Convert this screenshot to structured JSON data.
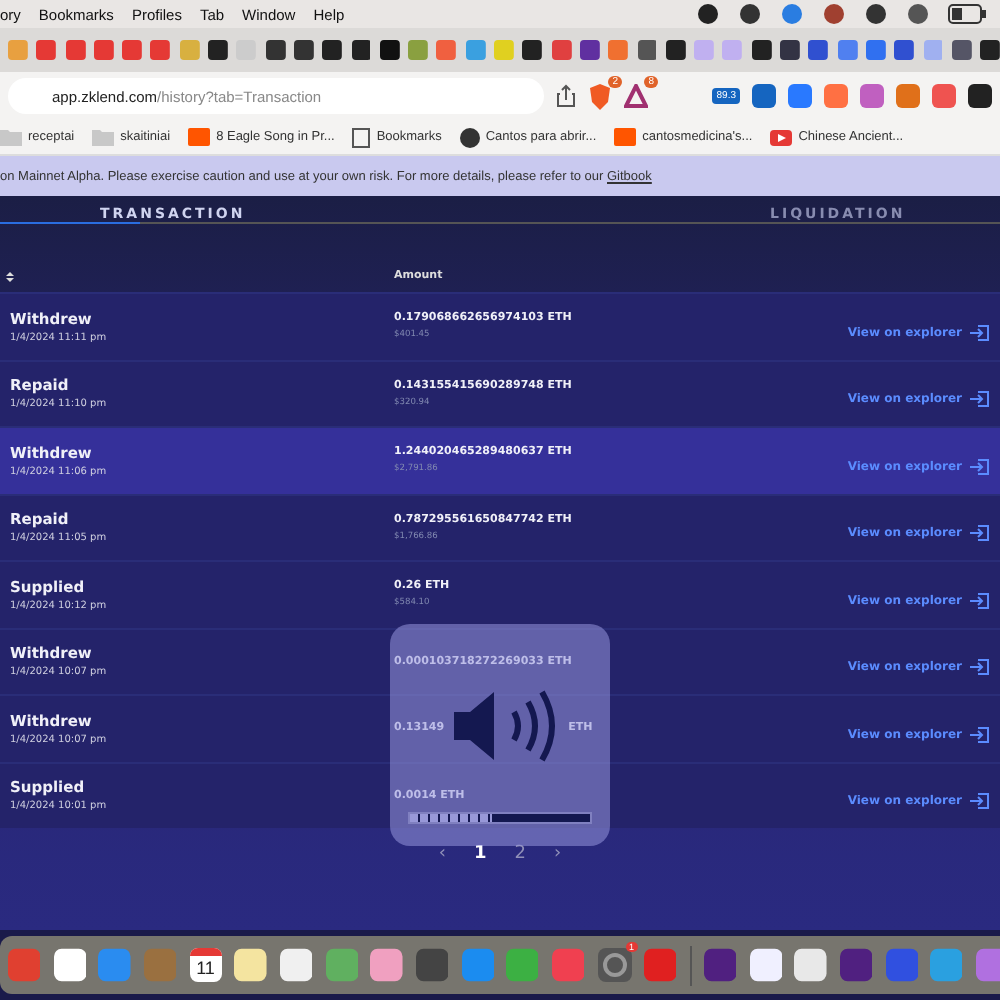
{
  "menu_bar": {
    "items": [
      "ory",
      "Bookmarks",
      "Profiles",
      "Tab",
      "Window",
      "Help"
    ]
  },
  "address_bar": {
    "host": "app.zklend.com",
    "path": "/history?tab=Transaction",
    "brave_badge": "2",
    "rewards_badge": "8",
    "extension_reading": "89.3"
  },
  "bookmarks": [
    {
      "label": "receptai",
      "kind": "folder"
    },
    {
      "label": "skaitiniai",
      "kind": "folder"
    },
    {
      "label": "8 Eagle Song in Pr...",
      "kind": "cloud"
    },
    {
      "label": "Bookmarks",
      "kind": "book"
    },
    {
      "label": "Cantos para abrir...",
      "kind": "globe"
    },
    {
      "label": "cantosmedicina's...",
      "kind": "cloud"
    },
    {
      "label": "Chinese Ancient...",
      "kind": "video"
    }
  ],
  "banner": {
    "text": "on Mainnet Alpha. Please exercise caution and use at your own risk. For more details, please refer to our",
    "link": "Gitbook"
  },
  "tabs": [
    {
      "label": "TRANSACTION",
      "selected": true
    },
    {
      "label": "LIQUIDATION",
      "selected": false
    }
  ],
  "table": {
    "columns": [
      "Amount"
    ],
    "rows": [
      {
        "action": "Withdrew",
        "time": "1/4/2024 11:11 pm",
        "amount": "0.179068662656974103 ETH",
        "usd": "$401.45",
        "link": "View on explorer",
        "highlighted": false
      },
      {
        "action": "Repaid",
        "time": "1/4/2024 11:10 pm",
        "amount": "0.143155415690289748 ETH",
        "usd": "$320.94",
        "link": "View on explorer",
        "highlighted": false
      },
      {
        "action": "Withdrew",
        "time": "1/4/2024 11:06 pm",
        "amount": "1.244020465289480637 ETH",
        "usd": "$2,791.86",
        "link": "View on explorer",
        "highlighted": true
      },
      {
        "action": "Repaid",
        "time": "1/4/2024 11:05 pm",
        "amount": "0.787295561650847742 ETH",
        "usd": "$1,766.86",
        "link": "View on explorer",
        "highlighted": false
      },
      {
        "action": "Supplied",
        "time": "1/4/2024 10:12 pm",
        "amount": "0.26 ETH",
        "usd": "$584.10",
        "link": "View on explorer",
        "highlighted": false
      },
      {
        "action": "Withdrew",
        "time": "1/4/2024 10:07 pm",
        "amount": "0.000103718272269033 ETH",
        "link": "View on explorer",
        "highlighted": false
      },
      {
        "action": "Withdrew",
        "time": "1/4/2024 10:07 pm",
        "amount": "0.13149",
        "amount_tail": "ETH",
        "link": "View on explorer",
        "highlighted": false
      },
      {
        "action": "Supplied",
        "time": "1/4/2024 10:01 pm",
        "amount": "0.0014 ETH",
        "link": "View on explorer",
        "highlighted": false
      }
    ]
  },
  "pagination": {
    "prev": "‹",
    "next": "›",
    "pages": [
      {
        "label": "1",
        "selected": true
      },
      {
        "label": "2",
        "selected": false
      }
    ]
  },
  "volume": {
    "level": 0.45
  },
  "dock": {
    "calendar_day": "11",
    "settings_badge": "1"
  }
}
